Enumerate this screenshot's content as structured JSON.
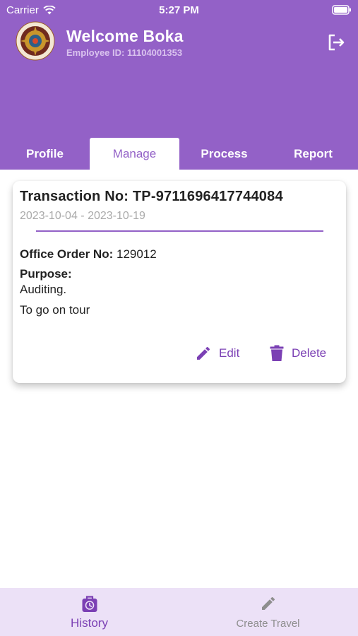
{
  "status_bar": {
    "carrier": "Carrier",
    "time": "5:27 PM"
  },
  "header": {
    "welcome": "Welcome Boka",
    "employee_id": "Employee ID: 11104001353",
    "logout_icon": "logout-icon"
  },
  "tabs": [
    {
      "label": "Profile",
      "active": false
    },
    {
      "label": "Manage",
      "active": true
    },
    {
      "label": "Process",
      "active": false
    },
    {
      "label": "Report",
      "active": false
    }
  ],
  "card": {
    "transaction": "Transaction No: TP-9711696417744084",
    "dates": "2023-10-04 - 2023-10-19",
    "office_order_label": "Office Order No:",
    "office_order_value": "129012",
    "purpose_label": "Purpose:",
    "purpose_lines": [
      "Auditing.",
      "To go on tour"
    ],
    "edit_label": "Edit",
    "delete_label": "Delete"
  },
  "bottom_nav": [
    {
      "label": "History",
      "icon": "history-icon",
      "active": true
    },
    {
      "label": "Create Travel",
      "icon": "pencil-icon",
      "active": false
    }
  ],
  "colors": {
    "accent": "#9361c7",
    "accent_dark": "#7b40b4",
    "nav_bg": "#ece1f7",
    "inactive": "#8e8e8e"
  }
}
